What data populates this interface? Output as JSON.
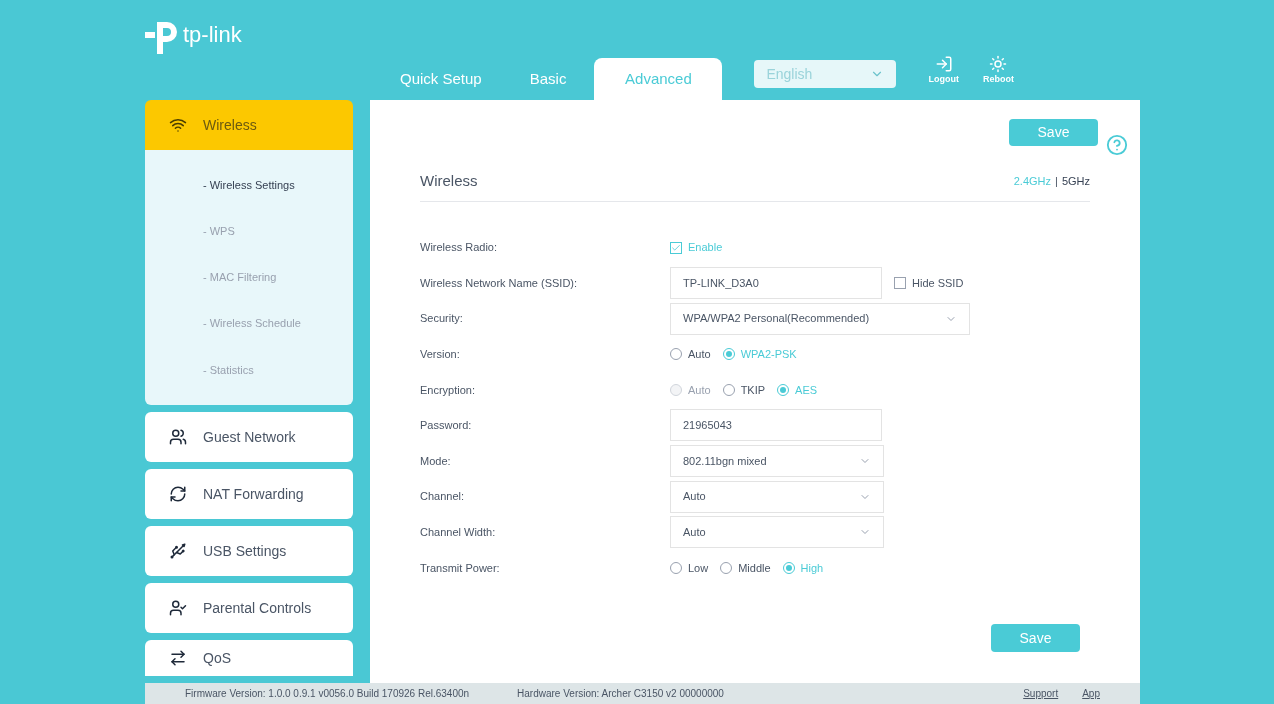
{
  "header": {
    "logo_text": "tp-link",
    "tabs": [
      {
        "label": "Quick Setup",
        "selected": false
      },
      {
        "label": "Basic",
        "selected": false
      },
      {
        "label": "Advanced",
        "selected": true
      }
    ],
    "language": "English",
    "actions": [
      {
        "label": "Logout",
        "kind": "logout"
      },
      {
        "label": "Reboot",
        "kind": "reboot"
      }
    ]
  },
  "sidebar": {
    "items": [
      {
        "label": "Wireless",
        "selected": true,
        "children": [
          {
            "label": "- Wireless Settings",
            "selected": true
          },
          {
            "label": "- WPS",
            "selected": false
          },
          {
            "label": "- MAC Filtering",
            "selected": false
          },
          {
            "label": "- Wireless Schedule",
            "selected": false
          },
          {
            "label": "- Statistics",
            "selected": false
          }
        ]
      },
      {
        "label": "Guest Network",
        "selected": false
      },
      {
        "label": "NAT Forwarding",
        "selected": false
      },
      {
        "label": "USB Settings",
        "selected": false
      },
      {
        "label": "Parental Controls",
        "selected": false
      },
      {
        "label": "QoS",
        "selected": false
      }
    ]
  },
  "main": {
    "save_top": "Save",
    "section_title": "Wireless",
    "bands": [
      {
        "label": "2.4GHz",
        "selected": true
      },
      {
        "label": "5GHz",
        "selected": false
      }
    ],
    "band_separator": "|",
    "rows": [
      {
        "label": "Wireless Radio:",
        "kind": "checkbox",
        "options": [
          {
            "label": "Enable",
            "checked": true
          }
        ]
      },
      {
        "label": "Wireless Network Name (SSID):",
        "kind": "text",
        "value": "TP-LINK_D3A0",
        "options": [
          {
            "label": "Hide SSID",
            "checked": false
          }
        ]
      },
      {
        "label": "Security:",
        "kind": "select",
        "value": "WPA/WPA2 Personal(Recommended)"
      },
      {
        "label": "Version:",
        "kind": "radio",
        "options": [
          {
            "label": "Auto",
            "selected": false,
            "disabled": false
          },
          {
            "label": "WPA2-PSK",
            "selected": true,
            "disabled": false
          }
        ]
      },
      {
        "label": "Encryption:",
        "kind": "radio",
        "options": [
          {
            "label": "Auto",
            "selected": false,
            "disabled": true
          },
          {
            "label": "TKIP",
            "selected": false,
            "disabled": false
          },
          {
            "label": "AES",
            "selected": true,
            "disabled": false
          }
        ]
      },
      {
        "label": "Password:",
        "kind": "text",
        "value": "21965043"
      },
      {
        "label": "Mode:",
        "kind": "select",
        "value": "802.11bgn mixed"
      },
      {
        "label": "Channel:",
        "kind": "select",
        "value": "Auto"
      },
      {
        "label": "Channel Width:",
        "kind": "select",
        "value": "Auto"
      },
      {
        "label": "Transmit Power:",
        "kind": "radio",
        "options": [
          {
            "label": "Low",
            "selected": false,
            "disabled": false
          },
          {
            "label": "Middle",
            "selected": false,
            "disabled": false
          },
          {
            "label": "High",
            "selected": true,
            "disabled": false
          }
        ]
      }
    ],
    "save_bottom": "Save"
  },
  "footer": {
    "firmware": "Firmware Version: 1.0.0 0.9.1 v0056.0 Build 170926 Rel.63400n",
    "hardware": "Hardware Version: Archer C3150 v2 00000000",
    "links": [
      "Support",
      "App"
    ]
  }
}
